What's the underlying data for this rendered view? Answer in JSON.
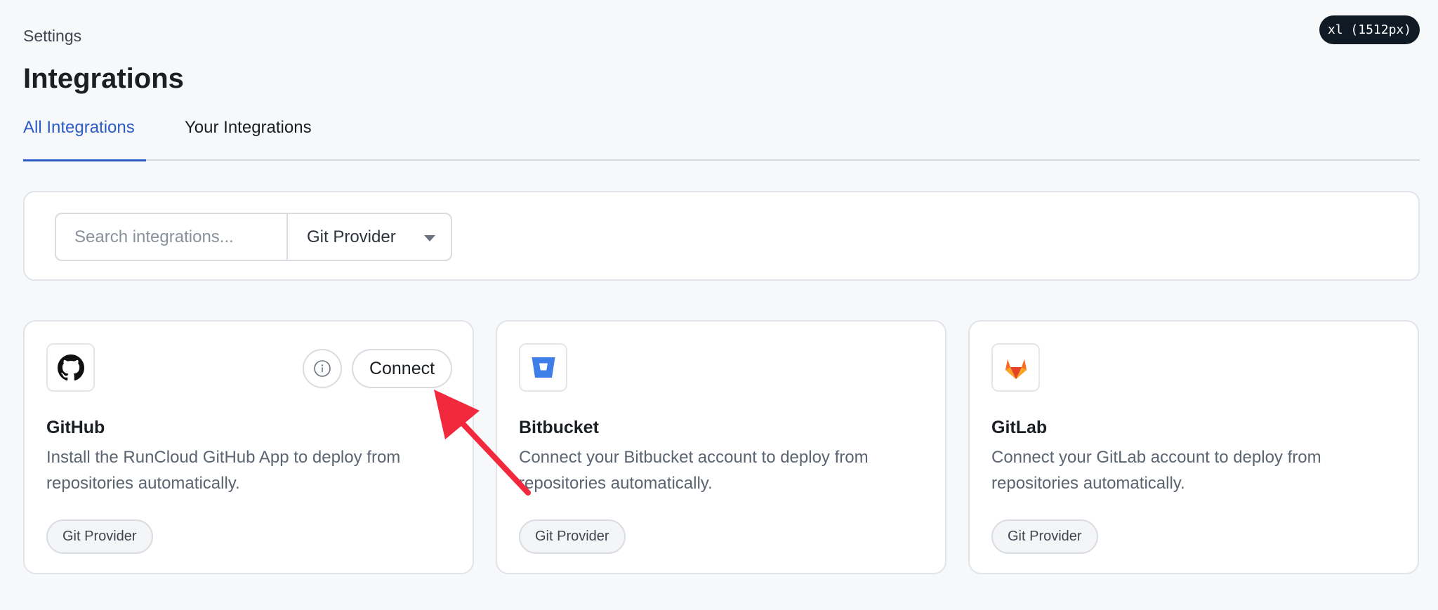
{
  "breakpoint_badge": "xl (1512px)",
  "breadcrumb": "Settings",
  "page_title": "Integrations",
  "tabs": [
    {
      "label": "All Integrations",
      "active": true
    },
    {
      "label": "Your Integrations",
      "active": false
    }
  ],
  "filters": {
    "search_placeholder": "Search integrations...",
    "search_value": "",
    "provider_select": "Git Provider"
  },
  "integrations": [
    {
      "name": "GitHub",
      "icon": "github-icon",
      "description": "Install the RunCloud GitHub App to deploy from repositories automatically.",
      "tag": "Git Provider",
      "connect_label": "Connect",
      "has_info_button": true
    },
    {
      "name": "Bitbucket",
      "icon": "bitbucket-icon",
      "description": "Connect your Bitbucket account to deploy from repositories automatically.",
      "tag": "Git Provider"
    },
    {
      "name": "GitLab",
      "icon": "gitlab-icon",
      "description": "Connect your GitLab account to deploy from repositories automatically.",
      "tag": "Git Provider"
    }
  ],
  "colors": {
    "accent": "#2c5cc5",
    "annotation_arrow": "#f2283c",
    "bitbucket": "#3f7de8",
    "gitlab": "#e2432a"
  }
}
